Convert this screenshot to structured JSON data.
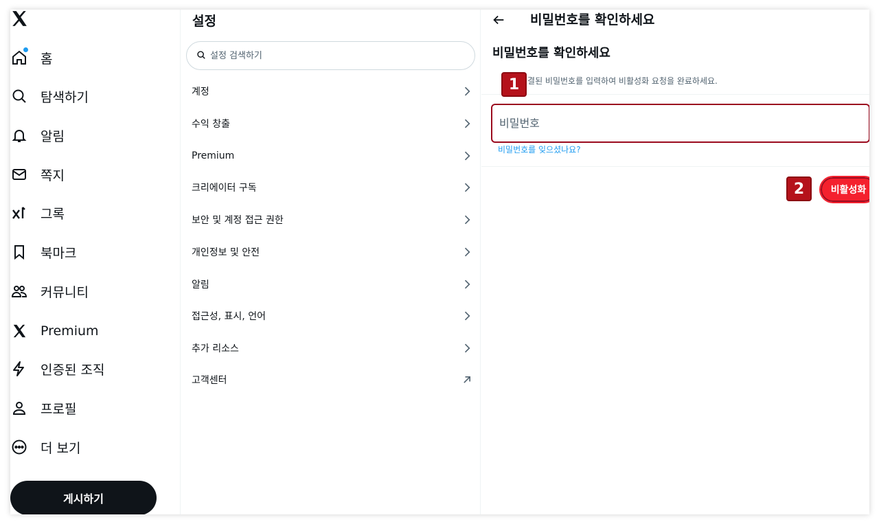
{
  "nav": {
    "items": [
      {
        "label": "홈",
        "icon": "home-icon"
      },
      {
        "label": "탐색하기",
        "icon": "search-icon"
      },
      {
        "label": "알림",
        "icon": "bell-icon"
      },
      {
        "label": "쪽지",
        "icon": "mail-icon"
      },
      {
        "label": "그록",
        "icon": "grok-icon"
      },
      {
        "label": "북마크",
        "icon": "bookmark-icon"
      },
      {
        "label": "커뮤니티",
        "icon": "communities-icon"
      },
      {
        "label": "Premium",
        "icon": "x-logo-icon"
      },
      {
        "label": "인증된 조직",
        "icon": "lightning-icon"
      },
      {
        "label": "프로필",
        "icon": "person-icon"
      },
      {
        "label": "더 보기",
        "icon": "more-circle-icon"
      }
    ],
    "post_button": "게시하기"
  },
  "settings": {
    "title": "설정",
    "search_placeholder": "설정 검색하기",
    "items": [
      {
        "label": "계정",
        "icon": "chevron-right-icon"
      },
      {
        "label": "수익 창출",
        "icon": "chevron-right-icon"
      },
      {
        "label": "Premium",
        "icon": "chevron-right-icon"
      },
      {
        "label": "크리에이터 구독",
        "icon": "chevron-right-icon"
      },
      {
        "label": "보안 및 계정 접근 권한",
        "icon": "chevron-right-icon"
      },
      {
        "label": "개인정보 및 안전",
        "icon": "chevron-right-icon"
      },
      {
        "label": "알림",
        "icon": "chevron-right-icon"
      },
      {
        "label": "접근성, 표시, 언어",
        "icon": "chevron-right-icon"
      },
      {
        "label": "추가 리소스",
        "icon": "chevron-right-icon"
      },
      {
        "label": "고객센터",
        "icon": "external-arrow-icon"
      }
    ]
  },
  "pane": {
    "header": "비밀번호를 확인하세요",
    "title": "비밀번호를 확인하세요",
    "description": "연결된 비밀번호를 입력하여 비활성화 요청을 완료하세요.",
    "password_placeholder": "비밀번호",
    "forgot_link": "비밀번호를 잊으셨나요?",
    "deactivate_button": "비활성화"
  },
  "annotations": {
    "badge1": "1",
    "badge2": "2"
  },
  "colors": {
    "accent": "#1d9bf0",
    "danger": "#f4212e",
    "annotation": "#b5121b"
  }
}
